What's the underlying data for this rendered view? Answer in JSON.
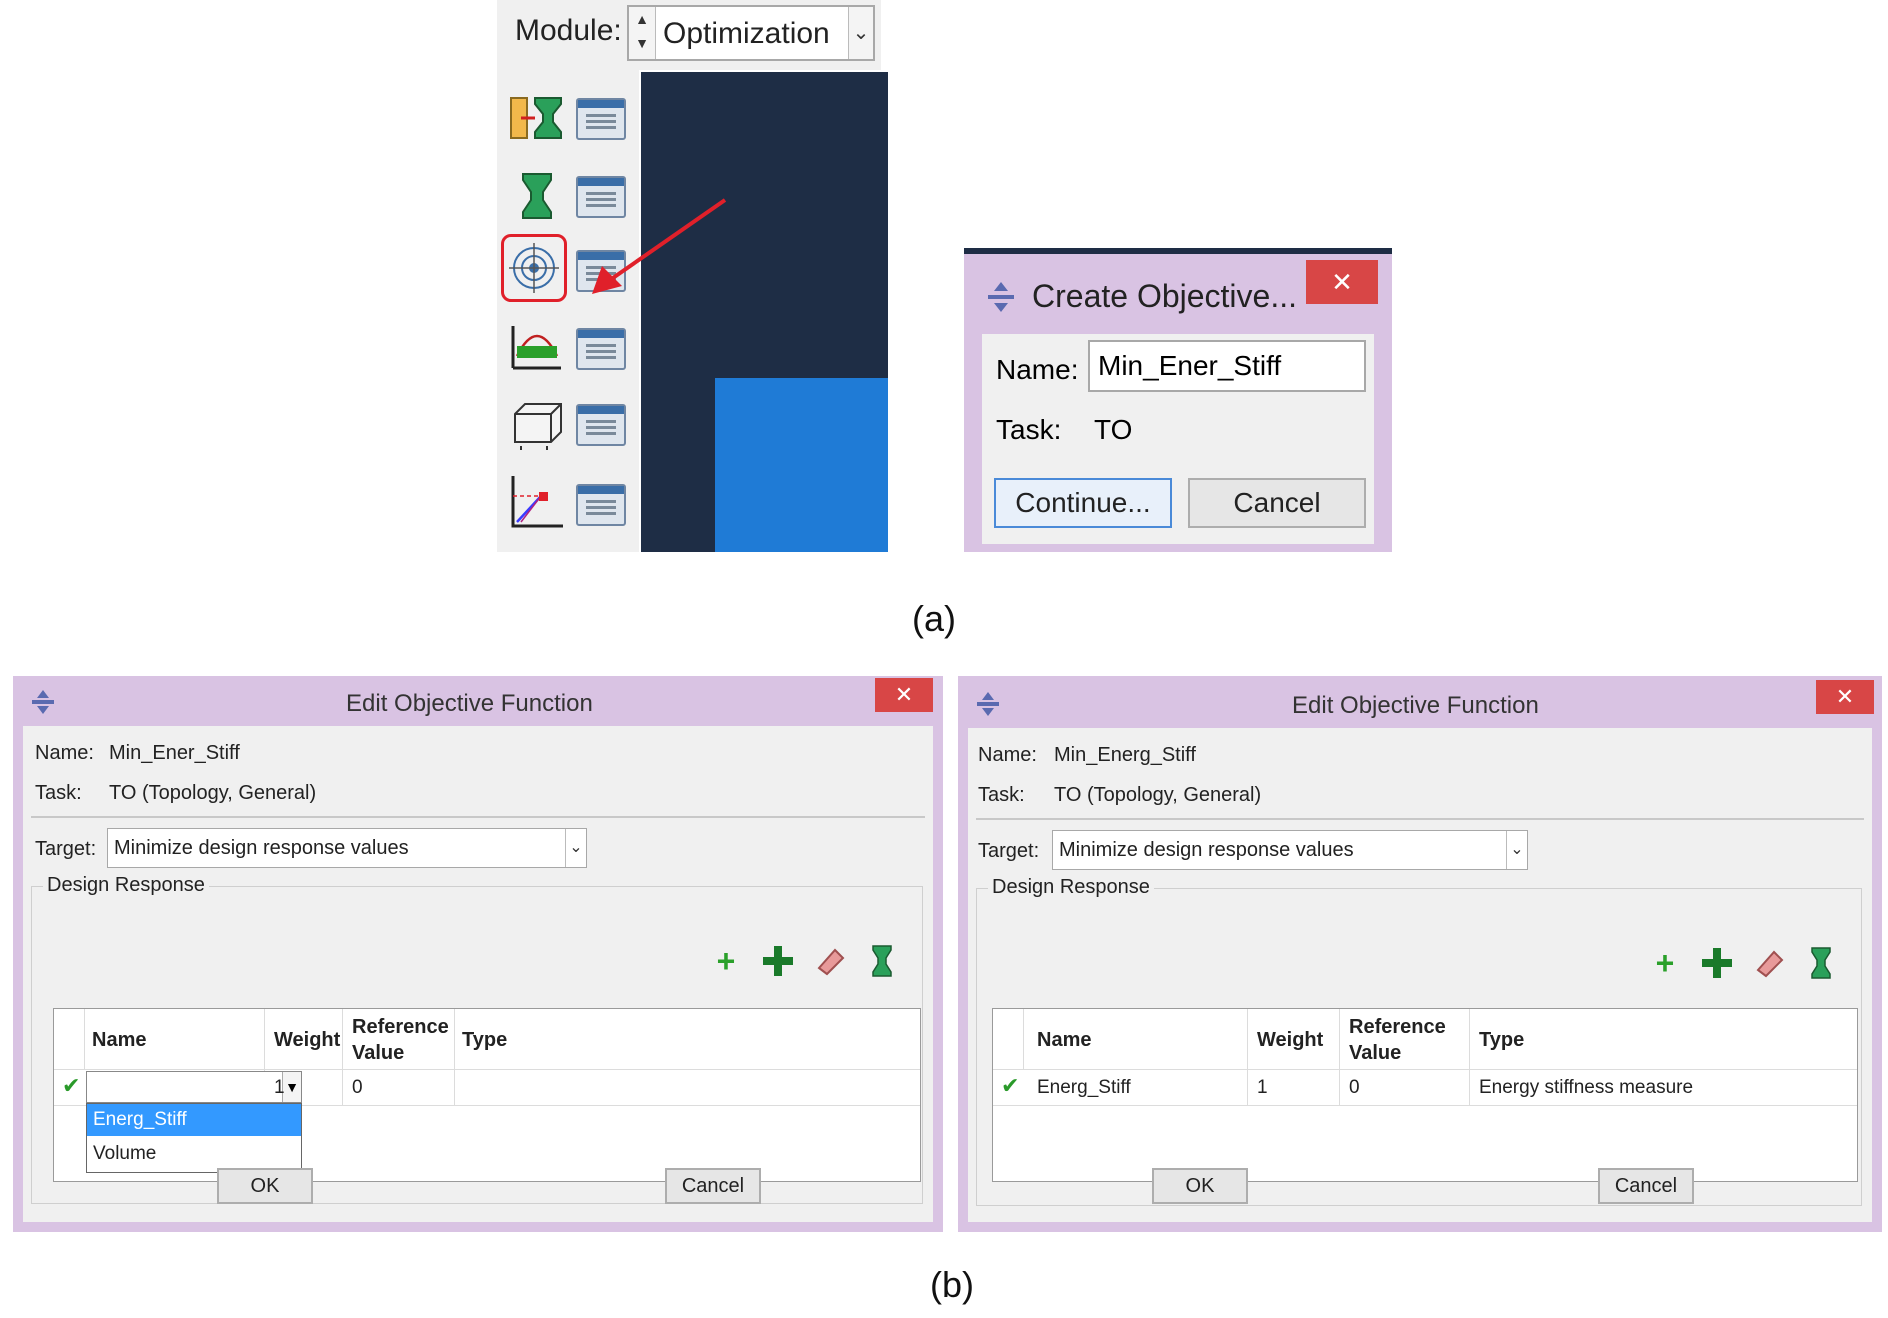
{
  "module": {
    "label": "Module:",
    "value": "Optimization"
  },
  "toolbox": {
    "tools": [
      {
        "icon": "create-task-icon"
      },
      {
        "icon": "design-response-icon"
      },
      {
        "icon": "objective-function-icon",
        "highlighted": true
      },
      {
        "icon": "constraint-icon"
      },
      {
        "icon": "geometric-restriction-icon"
      },
      {
        "icon": "stop-condition-icon"
      }
    ],
    "manager_icon": "manager-icon"
  },
  "create_dialog": {
    "title": "Create Objective...",
    "close": "✕",
    "name_label": "Name:",
    "name_value": "Min_Ener_Stiff",
    "task_label": "Task:",
    "task_value": "TO",
    "continue_label": "Continue...",
    "cancel_label": "Cancel"
  },
  "captions": {
    "a": "(a)",
    "b": "(b)"
  },
  "edit_left": {
    "title": "Edit Objective Function",
    "close": "✕",
    "name_label": "Name:",
    "name_value": "Min_Ener_Stiff",
    "task_label": "Task:",
    "task_value": "TO (Topology, General)",
    "target_label": "Target:",
    "target_value": "Minimize design response values",
    "group_label": "Design Response",
    "columns": [
      "Name",
      "Weight",
      "Reference\nValue",
      "Type"
    ],
    "row": {
      "name": "",
      "weight": "1",
      "ref": "0",
      "type": ""
    },
    "dropdown_options": [
      "Energ_Stiff",
      "Volume"
    ],
    "dropdown_selected": "Energ_Stiff",
    "ok_label": "OK",
    "cancel_label": "Cancel"
  },
  "edit_right": {
    "title": "Edit Objective Function",
    "close": "✕",
    "name_label": "Name:",
    "name_value": "Min_Energ_Stiff",
    "task_label": "Task:",
    "task_value": "TO (Topology, General)",
    "target_label": "Target:",
    "target_value": "Minimize design response values",
    "group_label": "Design Response",
    "columns": [
      "Name",
      "Weight",
      "Reference\nValue",
      "Type"
    ],
    "row": {
      "name": "Energ_Stiff",
      "weight": "1",
      "ref": "0",
      "type": "Energy stiffness measure"
    },
    "ok_label": "OK",
    "cancel_label": "Cancel"
  },
  "colors": {
    "dialog_frame": "#d9c3e3",
    "viewport": "#1e2d45",
    "part": "#1f7bd6",
    "highlight": "#e0202a",
    "selection": "#3399ff"
  }
}
